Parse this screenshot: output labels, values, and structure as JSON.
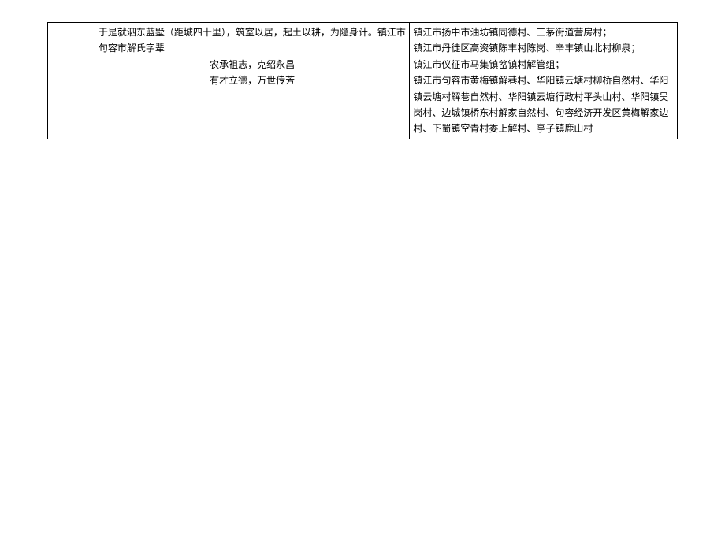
{
  "table": {
    "left_cell": {
      "line1": "于是就泗东蓝墅（距城四十里），筑室以居，起土以耕，为隐身计。镇江市句容市解氏字辈",
      "line2": "农承祖志，克绍永昌",
      "line3": "有才立德，万世传芳"
    },
    "right_cell": {
      "line1": "镇江市扬中市油坊镇同德村、三茅街道营房村；",
      "line2": "镇江市丹徒区高资镇陈丰村陈岗、辛丰镇山北村柳泉；",
      "line3": "镇江市仪征市马集镇岔镇村解管组；",
      "line4": "镇江市句容市黄梅镇解巷村、华阳镇云塘村柳桥自然村、华阳镇云塘村解巷自然村、华阳镇云塘行政村平头山村、华阳镇吴岗村、边城镇桥东村解家自然村、句容经济开发区黄梅解家边村、下蜀镇空青村委上解村、亭子镇鹿山村"
    }
  }
}
